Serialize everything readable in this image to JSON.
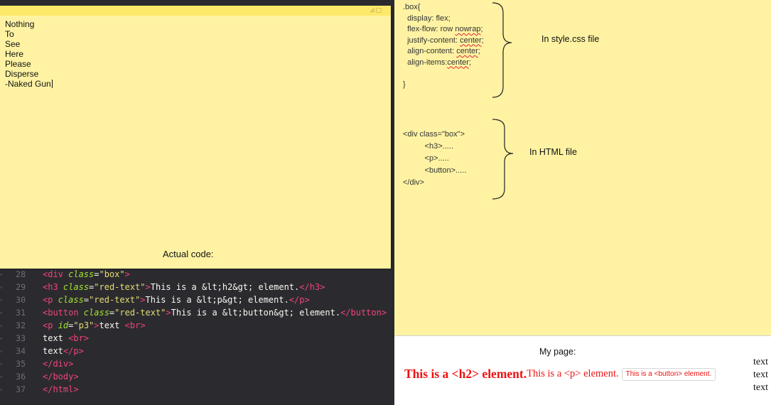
{
  "sticky_left": {
    "lines": [
      "Nothing",
      "To",
      "See",
      "Here",
      "Please",
      "Disperse",
      "-Naked Gun"
    ],
    "caption": "Actual code:",
    "window_controls": "⊿▢"
  },
  "editor": {
    "lines": [
      {
        "num": "28",
        "parts": [
          [
            "tag",
            "<div "
          ],
          [
            "attr",
            "class"
          ],
          [
            "punct",
            "="
          ],
          [
            "str",
            "\"box\""
          ],
          [
            "tag",
            ">"
          ]
        ]
      },
      {
        "num": "29",
        "parts": [
          [
            "tag",
            "<h3 "
          ],
          [
            "attr",
            "class"
          ],
          [
            "punct",
            "="
          ],
          [
            "str",
            "\"red-text\""
          ],
          [
            "tag",
            ">"
          ],
          [
            "txt",
            "This is a &lt;h2&gt; element."
          ],
          [
            "tag",
            "</h3>"
          ]
        ]
      },
      {
        "num": "30",
        "parts": [
          [
            "tag",
            "<p "
          ],
          [
            "attr",
            "class"
          ],
          [
            "punct",
            "="
          ],
          [
            "str",
            "\"red-text\""
          ],
          [
            "tag",
            ">"
          ],
          [
            "txt",
            "This is a &lt;p&gt; element."
          ],
          [
            "tag",
            "</p>"
          ]
        ]
      },
      {
        "num": "31",
        "parts": [
          [
            "tag",
            "<button "
          ],
          [
            "attr",
            "class"
          ],
          [
            "punct",
            "="
          ],
          [
            "str",
            "\"red-text\""
          ],
          [
            "tag",
            ">"
          ],
          [
            "txt",
            "This is a &lt;button&gt; element."
          ],
          [
            "tag",
            "</button>"
          ]
        ]
      },
      {
        "num": "32",
        "parts": [
          [
            "tag",
            "<p "
          ],
          [
            "attr",
            "id"
          ],
          [
            "punct",
            "="
          ],
          [
            "str",
            "\"p3\""
          ],
          [
            "tag",
            ">"
          ],
          [
            "txt",
            "text "
          ],
          [
            "tag",
            "<br>"
          ]
        ]
      },
      {
        "num": "33",
        "parts": [
          [
            "txt",
            "text "
          ],
          [
            "tag",
            "<br>"
          ]
        ]
      },
      {
        "num": "34",
        "parts": [
          [
            "txt",
            "text"
          ],
          [
            "tag",
            "</p>"
          ]
        ]
      },
      {
        "num": "35",
        "parts": [
          [
            "tag",
            "</div>"
          ]
        ]
      },
      {
        "num": "36",
        "parts": [
          [
            "tag",
            "</body>"
          ]
        ]
      },
      {
        "num": "37",
        "parts": [
          [
            "tag",
            "</html>"
          ]
        ]
      }
    ]
  },
  "sticky_right": {
    "css_lines": [
      ".box{",
      "  display: flex;",
      "  flex-flow: row nowrap;",
      "  justify-content: center;",
      "  align-content: center;",
      "  align-items:center;",
      "",
      "}"
    ],
    "css_squiggles": [
      "nowrap",
      "center",
      "align-items:center"
    ],
    "css_annotation": "In style.css file",
    "html_lines": [
      "<div class=\"box\">",
      "          <h3>.....",
      "          <p>.....",
      "          <button>.....",
      "</div>"
    ],
    "html_annotation": "In HTML file"
  },
  "my_page": {
    "label": "My page:",
    "h3_text": "This is a <h2> element.",
    "p_text": "This is a <p> element.",
    "button_text": "This is a <button> element.",
    "text_lines": [
      "text",
      "text",
      "text"
    ],
    "text_color": "#ee1111"
  }
}
